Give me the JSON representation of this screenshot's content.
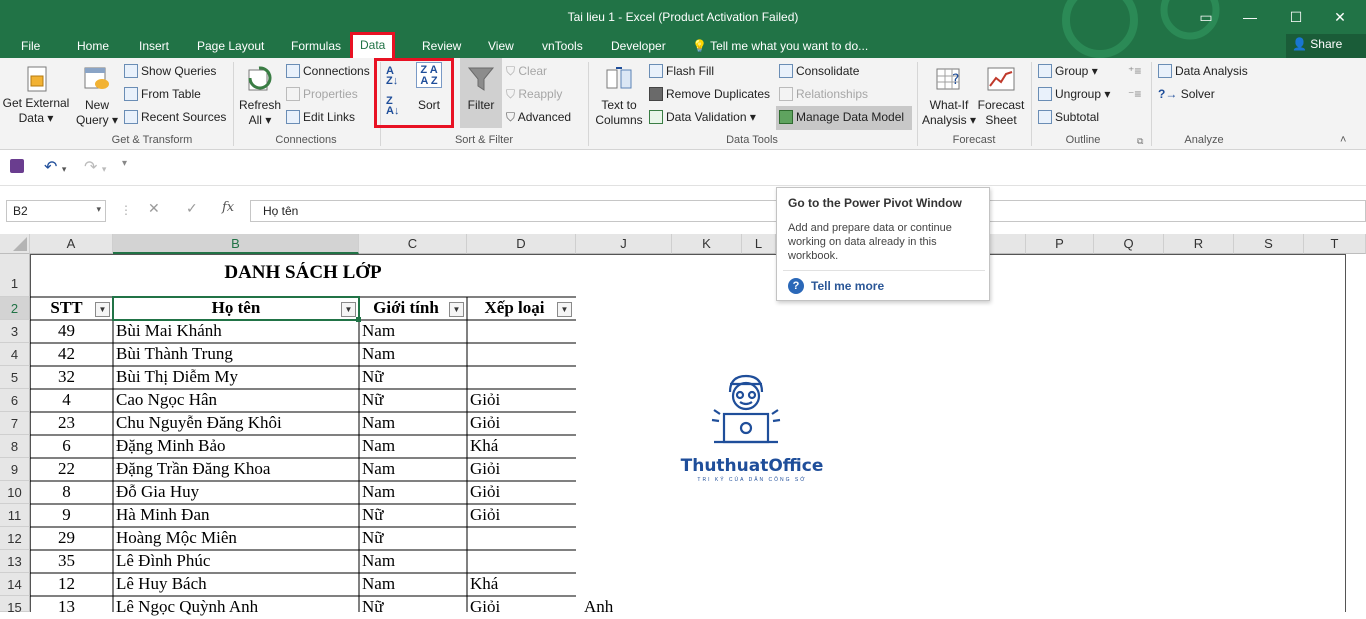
{
  "window": {
    "title": "Tai lieu 1  -  Excel (Product Activation Failed)",
    "share": "Share"
  },
  "tabs": [
    "File",
    "Home",
    "Insert",
    "Page Layout",
    "Formulas",
    "Data",
    "Review",
    "View",
    "vnTools",
    "Developer"
  ],
  "tell_me": "Tell me what you want to do...",
  "ribbon": {
    "get_external_data": [
      "Get External",
      "Data"
    ],
    "new_query": [
      "New",
      "Query"
    ],
    "show_queries": "Show Queries",
    "from_table": "From Table",
    "recent_sources": "Recent Sources",
    "group_get_transform": "Get & Transform",
    "refresh_all": [
      "Refresh",
      "All"
    ],
    "connections": "Connections",
    "properties": "Properties",
    "edit_links": "Edit Links",
    "group_connections": "Connections",
    "sort": "Sort",
    "filter": "Filter",
    "clear": "Clear",
    "reapply": "Reapply",
    "advanced": "Advanced",
    "group_sort_filter": "Sort & Filter",
    "text_to_columns": [
      "Text to",
      "Columns"
    ],
    "flash_fill": "Flash Fill",
    "remove_duplicates": "Remove Duplicates",
    "data_validation": "Data Validation",
    "consolidate": "Consolidate",
    "relationships": "Relationships",
    "manage_data_model": "Manage Data Model",
    "group_data_tools": "Data Tools",
    "what_if": [
      "What-If",
      "Analysis"
    ],
    "forecast_sheet": [
      "Forecast",
      "Sheet"
    ],
    "group_forecast": "Forecast",
    "group": "Group",
    "ungroup": "Ungroup",
    "subtotal": "Subtotal",
    "group_outline": "Outline",
    "data_analysis": "Data Analysis",
    "solver": "Solver",
    "group_analyze": "Analyze"
  },
  "formula_bar": {
    "name_box": "B2",
    "content": "Họ tên"
  },
  "columns": [
    "A",
    "B",
    "C",
    "D",
    "J",
    "K",
    "L",
    "P",
    "Q",
    "R",
    "S",
    "T"
  ],
  "rows": [
    "1",
    "2",
    "3",
    "4",
    "5",
    "6",
    "7",
    "8",
    "9",
    "10",
    "11",
    "12",
    "13",
    "14",
    "15"
  ],
  "sheet": {
    "title": "DANH SÁCH LỚP",
    "headers": [
      "STT",
      "Họ tên",
      "Giới tính",
      "Xếp loại"
    ],
    "data": [
      [
        "49",
        "Bùi Mai Khánh",
        "Nam",
        ""
      ],
      [
        "42",
        "Bùi Thành Trung",
        "Nam",
        ""
      ],
      [
        "32",
        "Bùi Thị Diễm My",
        "Nữ",
        ""
      ],
      [
        "4",
        "Cao Ngọc Hân",
        "Nữ",
        "Giỏi"
      ],
      [
        "23",
        "Chu Nguyễn Đăng Khôi",
        "Nam",
        "Giỏi"
      ],
      [
        "6",
        "Đặng Minh Bảo",
        "Nam",
        "Khá"
      ],
      [
        "22",
        "Đặng Trần Đăng Khoa",
        "Nam",
        "Giỏi"
      ],
      [
        "8",
        "Đỗ Gia Huy",
        "Nam",
        "Giỏi"
      ],
      [
        "9",
        "Hà Minh Đan",
        "Nữ",
        "Giỏi"
      ],
      [
        "29",
        "Hoàng Mộc Miên",
        "Nữ",
        ""
      ],
      [
        "35",
        "Lê Đình Phúc",
        "Nam",
        ""
      ],
      [
        "12",
        "Lê Huy Bách",
        "Nam",
        "Khá"
      ],
      [
        "13",
        "Lê Ngọc Quỳnh Anh",
        "Nữ",
        "Giỏi"
      ]
    ],
    "overflow_text": "Anh"
  },
  "tooltip": {
    "title": "Go to the Power Pivot Window",
    "body": "Add and prepare data or continue working on data already in this workbook.",
    "link": "Tell me more"
  },
  "logo": {
    "brand": "ThuthuatOffice",
    "tagline": "TRI KỶ CỦA DÂN CÔNG SỞ"
  },
  "colors": {
    "excel_green": "#217346",
    "highlight_red": "#e81123",
    "logo_blue": "#1f4e9a"
  }
}
